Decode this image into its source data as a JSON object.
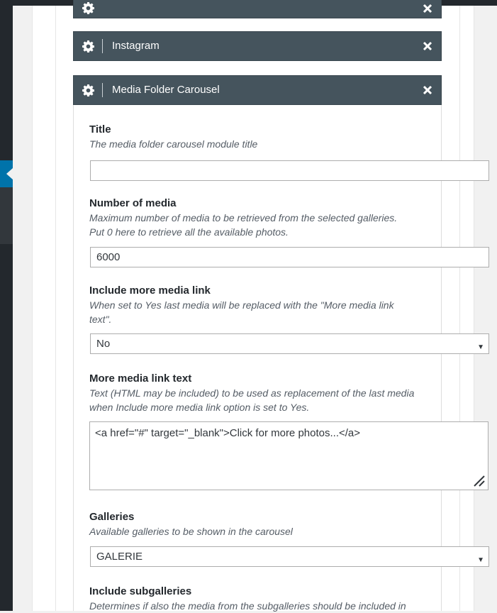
{
  "modules": {
    "instagram": {
      "label": "Instagram"
    },
    "media_folder_carousel": {
      "label": "Media Folder Carousel"
    }
  },
  "fields": {
    "title": {
      "label": "Title",
      "description": "The media folder carousel module title",
      "value": ""
    },
    "number_of_media": {
      "label": "Number of media",
      "description_line1": "Maximum number of media to be retrieved from the selected galleries.",
      "description_line2": "Put 0 here to retrieve all the available photos.",
      "value": "6000"
    },
    "include_more_media_link": {
      "label": "Include more media link",
      "description_line1": "When set to Yes last media will be replaced with the \"More media link",
      "description_line2": "text\".",
      "value": "No"
    },
    "more_media_link_text": {
      "label": "More media link text",
      "description_line1": "Text (HTML may be included) to be used as replacement of the last media",
      "description_line2": "when Include more media link option is set to Yes.",
      "value": "<a href=\"#\" target=\"_blank\">Click for more photos...</a>"
    },
    "galleries": {
      "label": "Galleries",
      "description": "Available galleries to be shown in the carousel",
      "value": "GALERIE"
    },
    "include_subgalleries": {
      "label": "Include subgalleries",
      "description": "Determines if also the media from the subgalleries should be included in"
    }
  },
  "icons": {
    "gear": "gear-icon",
    "close": "close-icon",
    "caret": "caret-down-icon",
    "resize": "resize-grip-icon"
  },
  "colors": {
    "header_bg": "#45545d",
    "admin_bar": "#23282d",
    "active_menu": "#0073aa"
  }
}
